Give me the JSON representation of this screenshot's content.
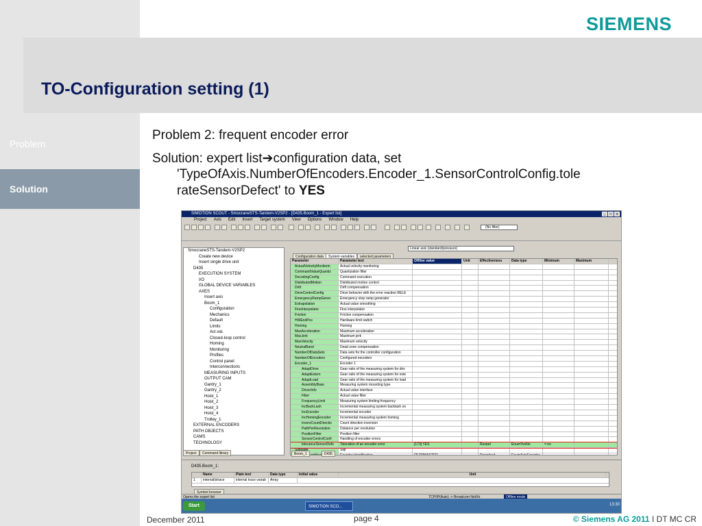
{
  "logo": "SIEMENS",
  "title": "TO-Configuration setting (1)",
  "nav": {
    "problem": "Problem",
    "solution": "Solution"
  },
  "body": {
    "line1": "Problem 2: frequent encoder error",
    "line2a": "Solution: expert list",
    "arrow": "➔",
    "line2b": "configuration data, set",
    "line3": "'TypeOfAxis.NumberOfEncoders.Encoder_1.SensorControlConfig.tole",
    "line4a": "rateSensorDefect' to ",
    "line4b": "YES"
  },
  "footer": {
    "date": "December 2011",
    "page": "page 4",
    "copyright": "© Siemens AG 2011",
    "sep": " I  DT MC CR"
  },
  "shot": {
    "title": "SIMOTION SCOUT - SmocraneSTS-Tandem-V2SP2 - [D435.Boom_1 - Expert list]",
    "menu": [
      "Project",
      "Axis",
      "Edit",
      "Insert",
      "Target system",
      "View",
      "Options",
      "Window",
      "Help"
    ],
    "filter": "(No filter)",
    "view": "Linear axis (standard/pressure)",
    "tabs": [
      "Configuration data",
      "System variables",
      "selected parameters"
    ],
    "tree": [
      "SmocraneSTS-Tandem-V2SP2",
      "Create new device",
      "Insert single drive unit",
      "D435",
      "EXECUTION SYSTEM",
      "I/O",
      "GLOBAL DEVICE VARIABLES",
      "AXES",
      "Insert axis",
      "Boom_1",
      "Configuration",
      "Mechanics",
      "Default",
      "Limits",
      "Act.val.",
      "Closed-loop control",
      "Homing",
      "Monitoring",
      "Profiles",
      "Control panel",
      "Interconnections",
      "MEASURING INPUTS",
      "OUTPUT CAM",
      "Gantry_1",
      "Gantry_2",
      "Hoist_1",
      "Hoist_2",
      "Hoist_3",
      "Hoist_4",
      "Trolley_1",
      "EXTERNAL ENCODERS",
      "PATH OBJECTS",
      "CAMS",
      "TECHNOLOGY"
    ],
    "treetabs": [
      "Project",
      "Command library"
    ],
    "headers": [
      "Parameter",
      "Parameter text",
      "Offline value",
      "Unit",
      "Effectiveness",
      "Data type",
      "Minimum",
      "Maximum"
    ],
    "rows": [
      [
        "ActualVelocityMonitorin",
        "Actual velocity monitoring"
      ],
      [
        "CommandValueQuantiz",
        "Quantization filter"
      ],
      [
        "DecodingConfig",
        "Command execution"
      ],
      [
        "DistributedMotion",
        "Distributed motion control"
      ],
      [
        "Drift",
        "Drift compensation"
      ],
      [
        "DriveControlConfig",
        "Drive behavior with the error reaction RELE"
      ],
      [
        "EmergencyRampGener",
        "Emergency stop ramp generator"
      ],
      [
        "Extrapolation",
        "Actual value smoothing"
      ],
      [
        "FineInterpolator",
        "Fine interpolator"
      ],
      [
        "Friction",
        "Friction compensation"
      ],
      [
        "HWEndPos",
        "Hardware limit switch"
      ],
      [
        "Homing",
        "Homing"
      ],
      [
        "MaxAcceleration",
        "Maximum acceleration"
      ],
      [
        "MaxJerk",
        "Maximum jerk"
      ],
      [
        "MaxVelocity",
        "Maximum velocity"
      ],
      [
        "NeutralBand",
        "Dead zone compensation"
      ],
      [
        "NumberOfDataSets",
        "Data sets for the controller configuration"
      ],
      [
        "NumberOfEncoders",
        "Configured encoders"
      ],
      [
        "Encoder_1",
        "Encoder 1"
      ],
      [
        "AdaptDrive",
        "Gear ratio of the measuring system for driv"
      ],
      [
        "AdaptExtern",
        "Gear ratio of the measuring system for exte"
      ],
      [
        "AdaptLoad",
        "Gear ratio of the measuring system for load"
      ],
      [
        "AssemblyBase",
        "Measuring system mounting type"
      ],
      [
        "DriverInfo",
        "Actual value interface"
      ],
      [
        "Filter",
        "Actual value filter"
      ],
      [
        "FrequencyLimit",
        "Measuring system limiting frequency"
      ],
      [
        "IncBackLash",
        "Incremental measuring system backlash on"
      ],
      [
        "IncEncoder",
        "Incremental encoder"
      ],
      [
        "IncHomingEncoder",
        "Incremental measuring system homing"
      ],
      [
        "InversCountDirectio",
        "Count direction inversion"
      ],
      [
        "PathPerRevolution",
        "Distance per revolution"
      ],
      [
        "PositionFilter",
        "Position filter"
      ],
      [
        "SensorControlConfi",
        "Handling of encoder errors"
      ],
      [
        "toleranceSensorDefe",
        "Toleration of an encoder error"
      ],
      [
        "Slippage",
        "Slip"
      ],
      [
        "encoderIdentification",
        "Encoder identification"
      ],
      [
        "encoderMode",
        "Encoder mode"
      ]
    ],
    "sel": {
      "value": "[173] YES",
      "eff": "Restart",
      "dtype": "EnumYesNo",
      "extra": "= en"
    },
    "ident": {
      "value": "[2] DPMASTER",
      "eff": "Download",
      "dtype": "EnumAxisEncoder"
    },
    "mode": {
      "value": "[1] RECTANGLE_TTL",
      "eff": "Download",
      "dtype": "EnumAxisEncoder"
    },
    "bottomtabs": [
      "Boom_1",
      "D435"
    ],
    "symbol_title": "D435.Boom_1:",
    "sym_headers": [
      "Name",
      "Plain text",
      "Data type",
      "Initial value",
      "Unit"
    ],
    "sym_row": [
      "internalIstrace",
      "internal trace variab",
      "Array"
    ],
    "symtab": "Symbol browser",
    "status": "Opens the expert list",
    "status2": "TCP/IP(Auto) -> Broadcom NetXtr",
    "status3": "Offline mode",
    "start": "Start",
    "task": "SIMOTION SCO...",
    "clock": "13:30"
  }
}
